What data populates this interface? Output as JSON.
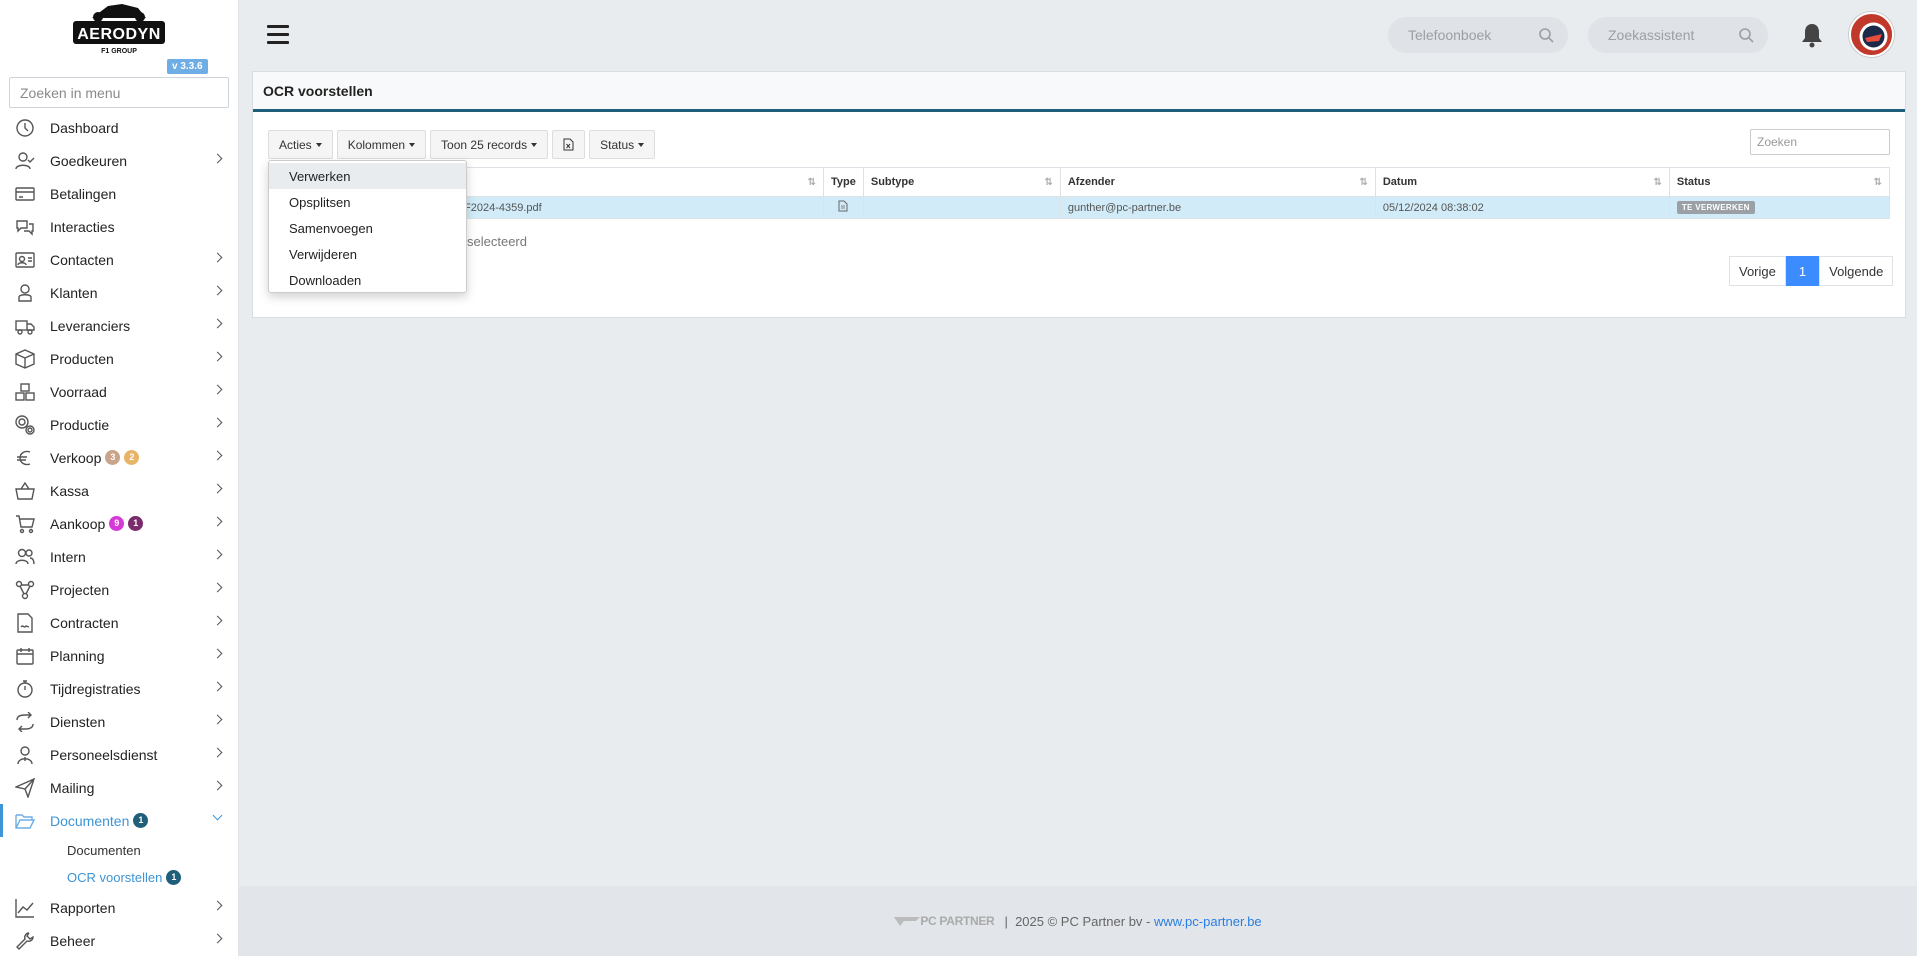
{
  "brand": {
    "logo_text": "AERODYN",
    "logo_sub": "F1 GROUP",
    "version": "v 3.3.6"
  },
  "sidebar": {
    "search_placeholder": "Zoeken in menu",
    "items": [
      {
        "label": "Dashboard",
        "icon": "dashboard-icon",
        "chevron": false
      },
      {
        "label": "Goedkeuren",
        "icon": "user-check-icon",
        "chevron": true
      },
      {
        "label": "Betalingen",
        "icon": "credit-card-icon",
        "chevron": false
      },
      {
        "label": "Interacties",
        "icon": "chat-icon",
        "chevron": false
      },
      {
        "label": "Contacten",
        "icon": "contact-card-icon",
        "chevron": true
      },
      {
        "label": "Klanten",
        "icon": "customer-icon",
        "chevron": true
      },
      {
        "label": "Leveranciers",
        "icon": "truck-icon",
        "chevron": true
      },
      {
        "label": "Producten",
        "icon": "box-icon",
        "chevron": true
      },
      {
        "label": "Voorraad",
        "icon": "boxes-icon",
        "chevron": true
      },
      {
        "label": "Productie",
        "icon": "gears-icon",
        "chevron": true
      },
      {
        "label": "Verkoop",
        "icon": "euro-icon",
        "chevron": true,
        "badges": [
          {
            "text": "3",
            "color": "#c9a48a"
          },
          {
            "text": "2",
            "color": "#e8b468"
          }
        ]
      },
      {
        "label": "Kassa",
        "icon": "basket-icon",
        "chevron": true
      },
      {
        "label": "Aankoop",
        "icon": "cart-icon",
        "chevron": true,
        "badges": [
          {
            "text": "9",
            "color": "#d63ad6"
          },
          {
            "text": "1",
            "color": "#7a2b6b"
          }
        ]
      },
      {
        "label": "Intern",
        "icon": "users-icon",
        "chevron": true
      },
      {
        "label": "Projecten",
        "icon": "project-icon",
        "chevron": true
      },
      {
        "label": "Contracten",
        "icon": "contract-icon",
        "chevron": true
      },
      {
        "label": "Planning",
        "icon": "calendar-icon",
        "chevron": true
      },
      {
        "label": "Tijdregistraties",
        "icon": "stopwatch-icon",
        "chevron": true
      },
      {
        "label": "Diensten",
        "icon": "repeat-icon",
        "chevron": true
      },
      {
        "label": "Personeelsdienst",
        "icon": "employee-icon",
        "chevron": true
      },
      {
        "label": "Mailing",
        "icon": "paper-plane-icon",
        "chevron": true
      },
      {
        "label": "Documenten",
        "icon": "folder-open-icon",
        "chevron": true,
        "active": true,
        "badges": [
          {
            "text": "1",
            "color": "#1f5f7a"
          }
        ]
      }
    ],
    "sub_items": [
      {
        "label": "Documenten",
        "active": false
      },
      {
        "label": "OCR voorstellen",
        "active": true,
        "badge": "1"
      }
    ],
    "after_items": [
      {
        "label": "Rapporten",
        "icon": "chart-line-icon",
        "chevron": true
      },
      {
        "label": "Beheer",
        "icon": "wrench-icon",
        "chevron": true
      }
    ]
  },
  "topbar": {
    "phonebook_placeholder": "Telefoonboek",
    "assistant_placeholder": "Zoekassistent"
  },
  "page": {
    "title": "OCR voorstellen",
    "toolbar": {
      "acties": "Acties",
      "kolommen": "Kolommen",
      "toon": "Toon 25 records",
      "status": "Status"
    },
    "search_placeholder": "Zoeken",
    "columns": [
      "",
      "Type",
      "Subtype",
      "Afzender",
      "Datum",
      "Status"
    ],
    "rows": [
      {
        "name": "F2024-4359.pdf",
        "type_icon": "file-icon",
        "subtype": "",
        "sender": "gunther@pc-partner.be",
        "date": "05/12/2024 08:38:02",
        "status": "TE VERWERKEN"
      }
    ],
    "selection_info": "selecteerd",
    "pager": {
      "prev": "Vorige",
      "current": "1",
      "next": "Volgende"
    }
  },
  "dropdown": {
    "items": [
      "Verwerken",
      "Opsplitsen",
      "Samenvoegen",
      "Verwijderen",
      "Downloaden"
    ],
    "hovered": 0
  },
  "footer": {
    "logo": "PC PARTNER",
    "separator": "|",
    "copyright": "2025 © PC Partner bv - ",
    "link": "www.pc-partner.be"
  }
}
